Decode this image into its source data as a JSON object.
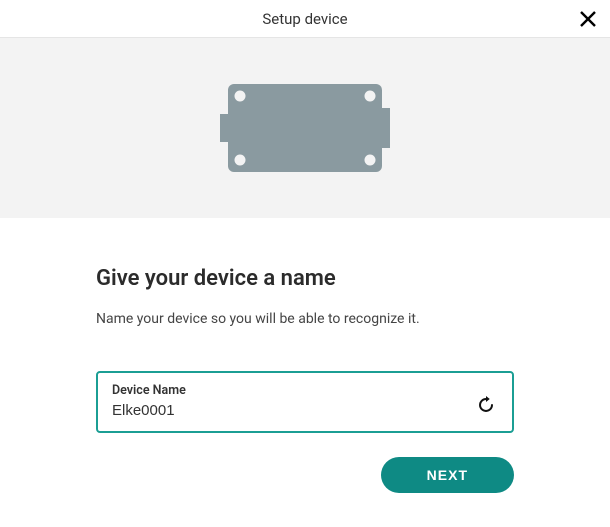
{
  "header": {
    "title": "Setup device"
  },
  "content": {
    "heading": "Give your device a name",
    "subtext": "Name your device so you will be able to recognize it.",
    "field_label": "Device Name",
    "device_name_value": "Elke0001"
  },
  "actions": {
    "next_label": "NEXT"
  },
  "icons": {
    "close": "close-icon",
    "refresh": "refresh-icon",
    "device": "device-board-icon"
  },
  "colors": {
    "accent": "#0e8a84",
    "border_focus": "#1b9e94",
    "hero_bg": "#f3f3f3",
    "device_fill": "#8a9aa0"
  }
}
